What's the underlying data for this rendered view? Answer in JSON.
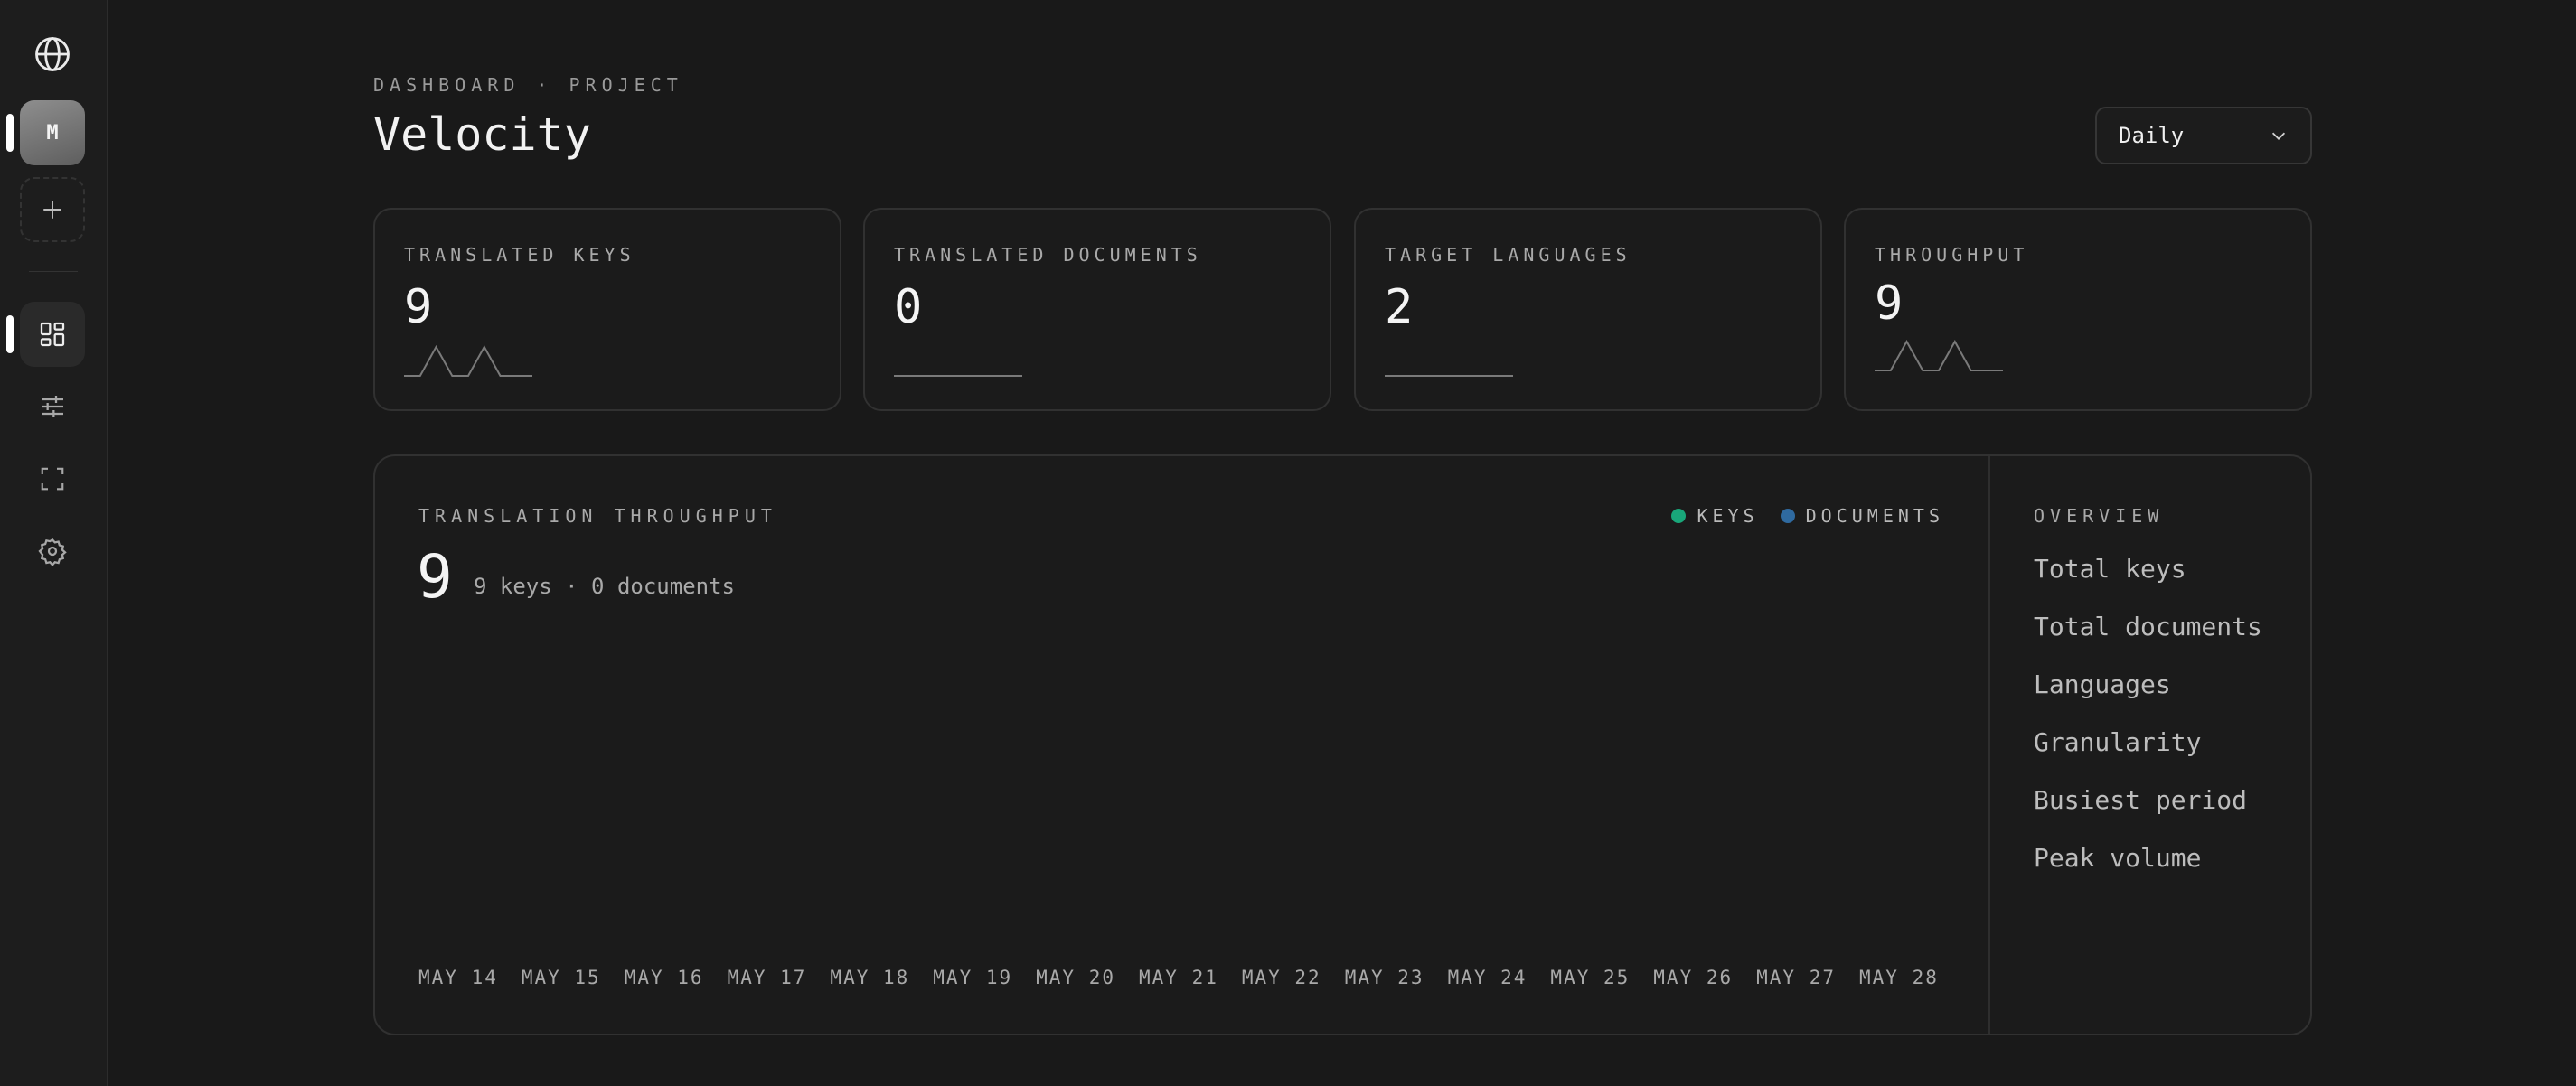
{
  "sidebar": {
    "avatar_initial": "M",
    "items": [
      {
        "icon": "globe-icon"
      },
      {
        "icon": "avatar",
        "active": true
      },
      {
        "icon": "plus-icon"
      },
      {
        "icon": "dashboard-icon",
        "active": true
      },
      {
        "icon": "sliders-icon"
      },
      {
        "icon": "focus-frame-icon"
      },
      {
        "icon": "gear-icon"
      }
    ]
  },
  "header": {
    "breadcrumb": "DASHBOARD · PROJECT",
    "title": "Velocity",
    "granularity_select": "Daily"
  },
  "stats": [
    {
      "label": "TRANSLATED KEYS",
      "value": "9",
      "sparkline": [
        0,
        0,
        1,
        0,
        0,
        1,
        0,
        0,
        0
      ]
    },
    {
      "label": "TRANSLATED DOCUMENTS",
      "value": "0",
      "sparkline": [
        0,
        0,
        0,
        0,
        0,
        0,
        0,
        0,
        0
      ]
    },
    {
      "label": "TARGET LANGUAGES",
      "value": "2",
      "sparkline": [
        0,
        0,
        0,
        0,
        0,
        0,
        0,
        0,
        0
      ]
    },
    {
      "label": "THROUGHPUT",
      "value": "9",
      "sparkline": [
        0,
        0,
        1,
        0,
        0,
        1,
        0,
        0,
        0
      ]
    }
  ],
  "chart": {
    "label": "TRANSLATION THROUGHPUT",
    "total": "9",
    "summary": "9 keys · 0 documents",
    "legend": [
      {
        "name": "KEYS",
        "color": "#19a77a"
      },
      {
        "name": "DOCUMENTS",
        "color": "#2f6aa0"
      }
    ],
    "x_ticks": [
      "MAY 14",
      "MAY 15",
      "MAY 16",
      "MAY 17",
      "MAY 18",
      "MAY 19",
      "MAY 20",
      "MAY 21",
      "MAY 22",
      "MAY 23",
      "MAY 24",
      "MAY 25",
      "MAY 26",
      "MAY 27",
      "MAY 28"
    ]
  },
  "overview": {
    "title": "OVERVIEW",
    "items": [
      "Total keys",
      "Total documents",
      "Languages",
      "Granularity",
      "Busiest period",
      "Peak volume"
    ]
  }
}
